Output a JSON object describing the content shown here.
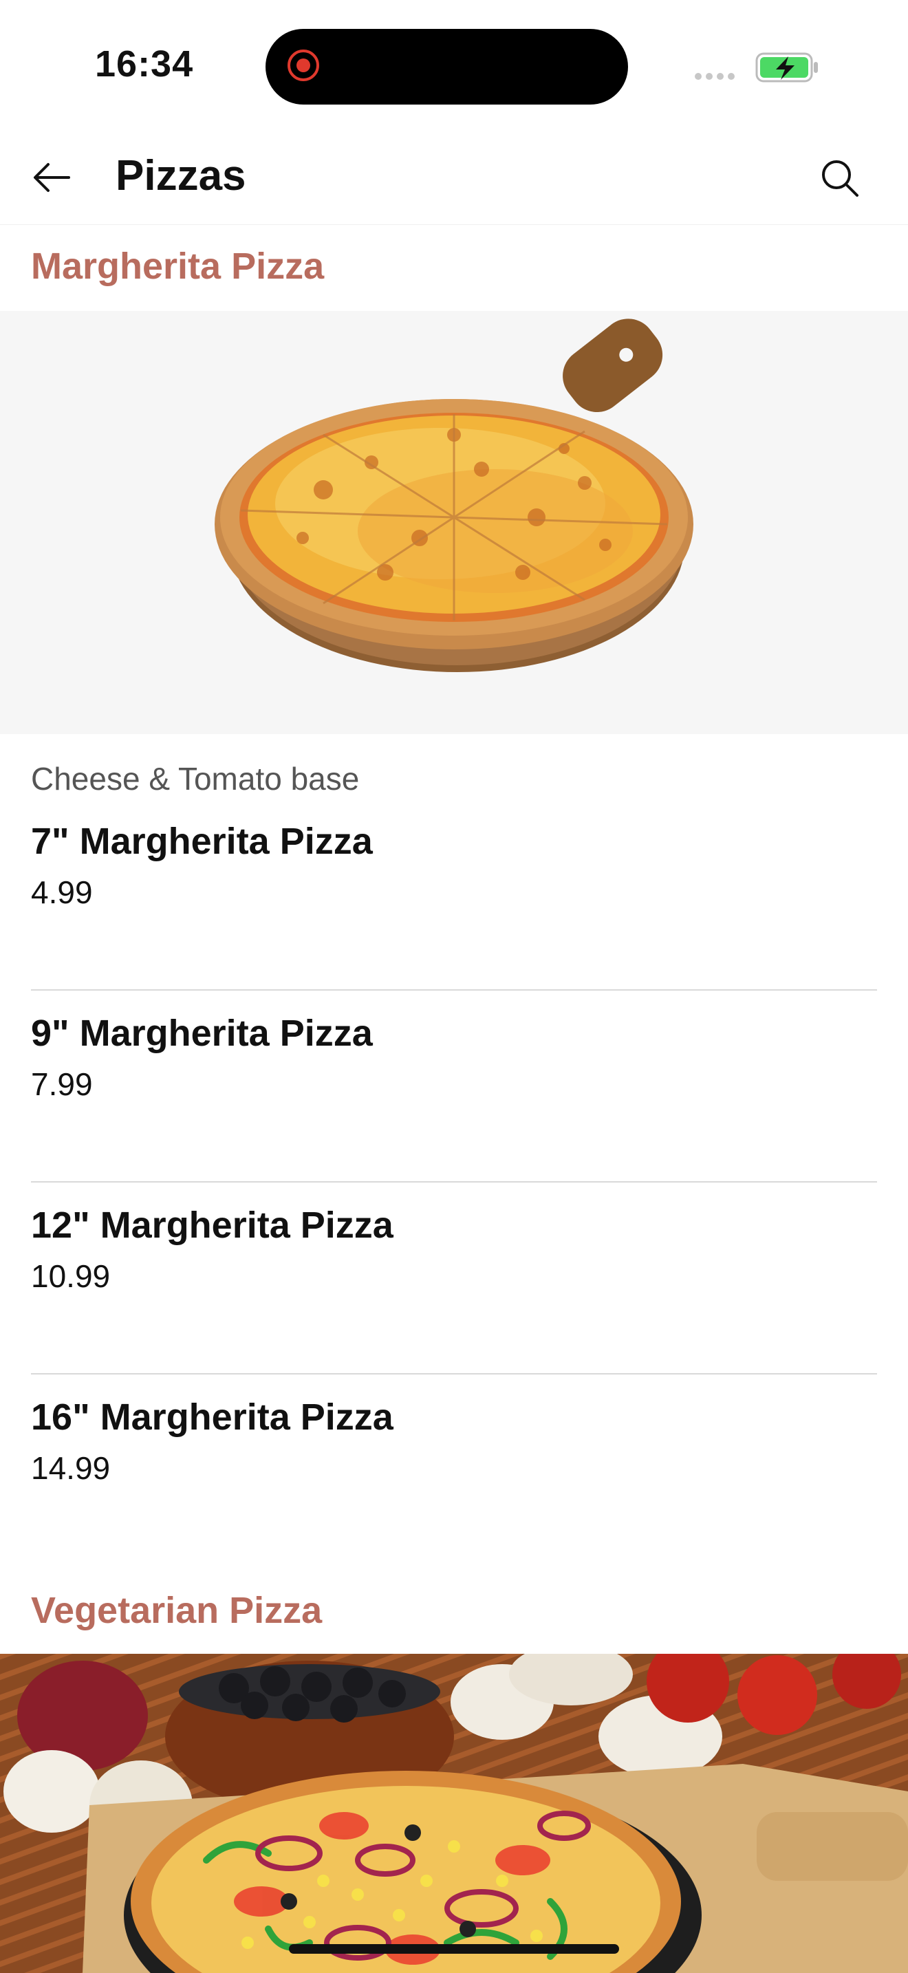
{
  "status_bar": {
    "time": "16:34"
  },
  "header": {
    "title": "Pizzas"
  },
  "sections": [
    {
      "title": "Margherita Pizza",
      "subtitle": "Cheese & Tomato base",
      "items": [
        {
          "name": "7\" Margherita Pizza",
          "price": "4.99"
        },
        {
          "name": "9\" Margherita Pizza",
          "price": "7.99"
        },
        {
          "name": "12\" Margherita Pizza",
          "price": "10.99"
        },
        {
          "name": "16\" Margherita Pizza",
          "price": "14.99"
        }
      ]
    },
    {
      "title": "Vegetarian Pizza"
    }
  ],
  "colors": {
    "accent": "#b86c5e",
    "battery": "#4cd964"
  }
}
